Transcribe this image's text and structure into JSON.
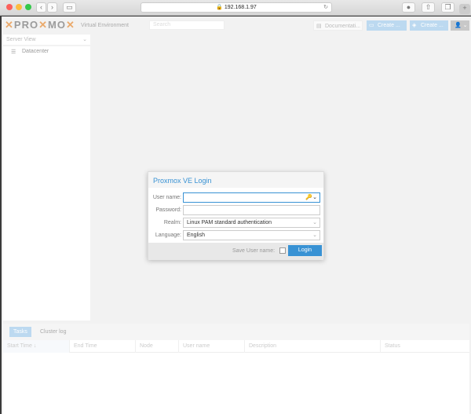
{
  "browser": {
    "url": "192.168.1.97",
    "back": "‹",
    "forward": "›",
    "new_tab": "+"
  },
  "header": {
    "logo": "PROXMOX",
    "subtitle": "Virtual Environment",
    "search_placeholder": "Search",
    "documentation": "Documentati...",
    "create_vm": "Create ...",
    "create_ct": "Create ...",
    "accent": "#3892d4"
  },
  "sidebar": {
    "view": "Server View",
    "tree": [
      {
        "label": "Datacenter"
      }
    ]
  },
  "login": {
    "title": "Proxmox VE Login",
    "username_label": "User name:",
    "username_value": "",
    "password_label": "Password:",
    "realm_label": "Realm:",
    "realm_value": "Linux PAM standard authentication",
    "language_label": "Language:",
    "language_value": "English",
    "save_label": "Save User name:",
    "save_checked": false,
    "login_button": "Login"
  },
  "bottom": {
    "tabs": [
      "Tasks",
      "Cluster log"
    ],
    "columns": [
      "Start Time ↓",
      "End Time",
      "Node",
      "User name",
      "Description",
      "Status"
    ]
  }
}
